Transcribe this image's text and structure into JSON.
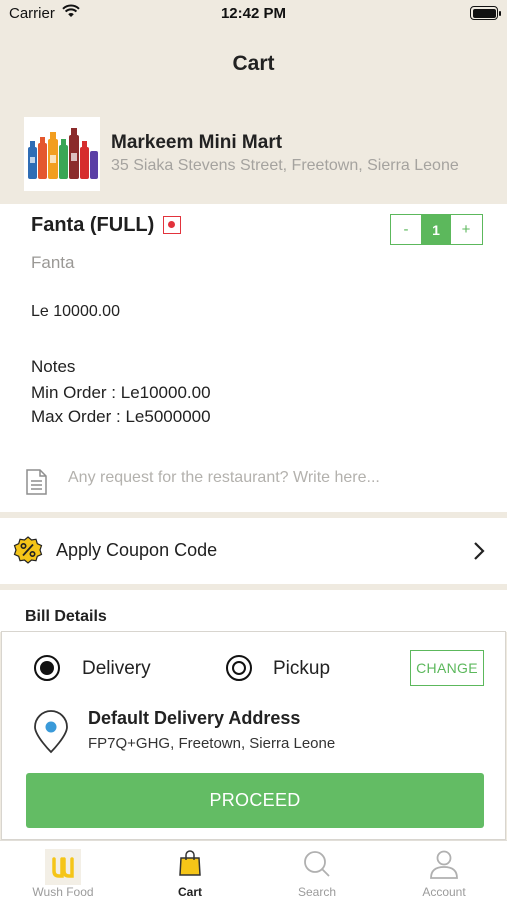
{
  "status_bar": {
    "carrier": "Carrier",
    "time": "12:42 PM"
  },
  "nav": {
    "title": "Cart"
  },
  "store": {
    "name": "Markeem Mini Mart",
    "address": "35 Siaka Stevens Street, Freetown, Sierra Leone"
  },
  "item": {
    "name": "Fanta (FULL)",
    "subtitle": "Fanta",
    "quantity": "1",
    "minus_label": "-",
    "plus_label": "+",
    "price": "Le 10000.00",
    "notes_title": "Notes",
    "min_order": "Min Order : Le10000.00",
    "max_order": "Max Order : Le5000000",
    "veg_mark_color": "#e2333c"
  },
  "request": {
    "placeholder": "Any request for the restaurant? Write here..."
  },
  "coupon": {
    "label": "Apply Coupon Code",
    "icon": "percent-badge-icon"
  },
  "bill": {
    "title": "Bill Details"
  },
  "checkout": {
    "delivery_label": "Delivery",
    "pickup_label": "Pickup",
    "change_label": "CHANGE",
    "address_title": "Default Delivery Address",
    "address": "FP7Q+GHG, Freetown, Sierra Leone",
    "proceed_label": "PROCEED",
    "selected_mode": "Delivery"
  },
  "tabs": [
    {
      "label": "Wush Food",
      "icon": "wush-logo-icon"
    },
    {
      "label": "Cart",
      "icon": "shopping-bag-icon"
    },
    {
      "label": "Search",
      "icon": "search-icon"
    },
    {
      "label": "Account",
      "icon": "person-icon"
    }
  ],
  "colors": {
    "accent": "#5cb85c",
    "background": "#efeae0",
    "coupon": "#f5c518",
    "pin": "#3a9ad9"
  }
}
